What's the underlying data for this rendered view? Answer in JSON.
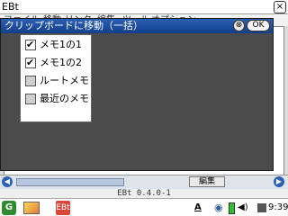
{
  "titlebar": {
    "title": "EBt",
    "close": "×"
  },
  "menubar": {
    "items": [
      "ファイル",
      "移動",
      "リンク",
      "編集",
      "ツール",
      "オプション"
    ]
  },
  "background": {
    "fragment_1": "リ",
    "fragment_2": "ル",
    "tree_marker": "−",
    "edit_button": "編集"
  },
  "statusbar": {
    "text": "EBt 0.4.0-1"
  },
  "taskbar": {
    "ime_indicator": "A",
    "clock": "9:39"
  },
  "dialog": {
    "title": "クリップボードに移動（一括）",
    "close_label": "⊗",
    "ok_label": "OK",
    "items": [
      {
        "label": "メモ1の1",
        "checked": true
      },
      {
        "label": "メモ1の2",
        "checked": true
      },
      {
        "label": "ルートメモ",
        "checked": false
      },
      {
        "label": "最近のメモ",
        "checked": false
      }
    ]
  }
}
